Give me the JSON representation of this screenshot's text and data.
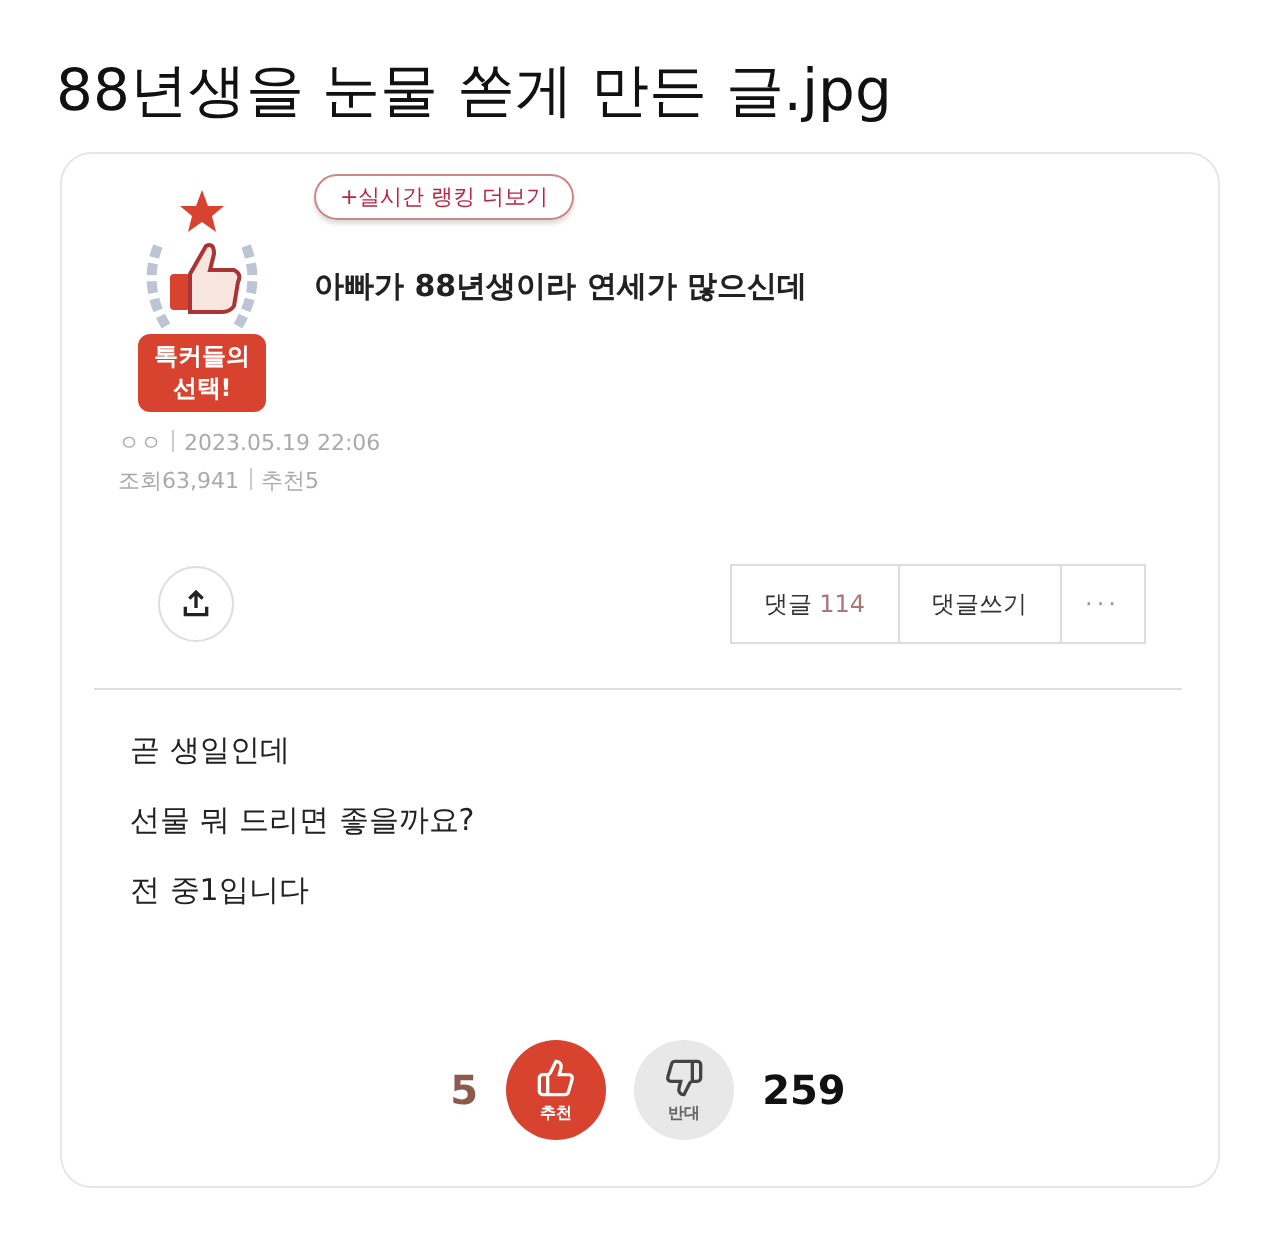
{
  "headline": "88년생을 눈물 쏟게 만든 글.jpg",
  "post": {
    "badge": "톡커들의 선택!",
    "ranking_link": "+실시간 랭킹 더보기",
    "title": "아빠가 88년생이라 연세가 많으신데",
    "author": "ㅇㅇ",
    "date": "2023.05.19 22:06",
    "views": "조회63,941",
    "recommends": "추천5",
    "actions": [
      {
        "kind": "count",
        "label": "댓글",
        "count": "114"
      },
      {
        "kind": "write",
        "label": "댓글쓰기"
      },
      {
        "kind": "more",
        "label": "···"
      }
    ],
    "body": [
      "곧 생일인데",
      "선물 뭐 드리면 좋을까요?",
      "전 중1입니다"
    ],
    "votes": [
      {
        "kind": "up",
        "label": "추천",
        "count": "5"
      },
      {
        "kind": "down",
        "label": "반대",
        "count": "259"
      }
    ]
  }
}
